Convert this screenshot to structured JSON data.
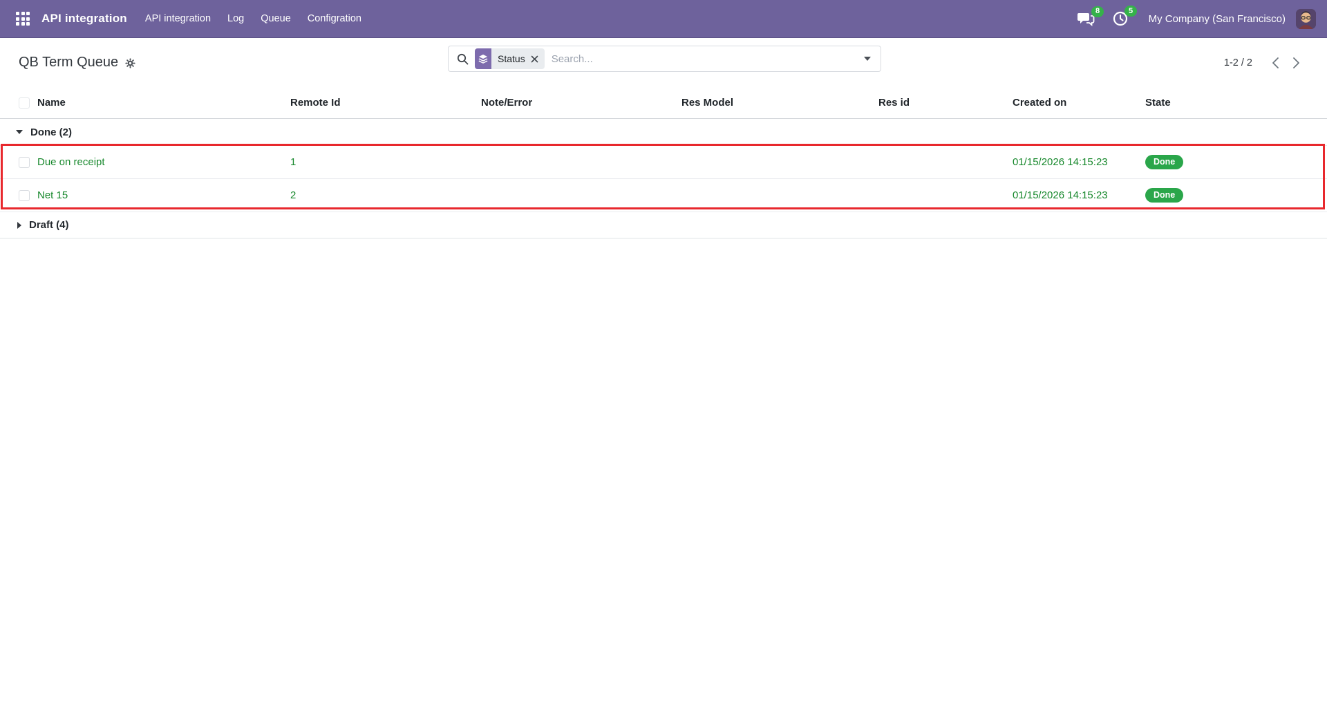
{
  "navbar": {
    "brand": "API integration",
    "menu": [
      {
        "label": "API integration"
      },
      {
        "label": "Log"
      },
      {
        "label": "Queue"
      },
      {
        "label": "Configration"
      }
    ],
    "messages_count": "8",
    "activities_count": "5",
    "company": "My Company (San Francisco)"
  },
  "control_panel": {
    "title": "QB Term Queue",
    "search": {
      "facet": "Status",
      "placeholder": "Search..."
    },
    "pager": {
      "range": "1-2 / 2"
    }
  },
  "table": {
    "headers": [
      "Name",
      "Remote Id",
      "Note/Error",
      "Res Model",
      "Res id",
      "Created on",
      "State"
    ],
    "groups": [
      {
        "label": "Done (2)",
        "expanded": true,
        "rows": [
          {
            "name": "Due on receipt",
            "remote_id": "1",
            "note_error": "",
            "res_model": "",
            "res_id": "",
            "created_on": "01/15/2026 14:15:23",
            "state": "Done"
          },
          {
            "name": "Net 15",
            "remote_id": "2",
            "note_error": "",
            "res_model": "",
            "res_id": "",
            "created_on": "01/15/2026 14:15:23",
            "state": "Done"
          }
        ]
      },
      {
        "label": "Draft (4)",
        "expanded": false
      }
    ]
  },
  "icons": {
    "apps": "grid-3x3",
    "messages": "chat-bubbles",
    "activities": "clock",
    "search": "magnifier",
    "group_by_facet": "layers",
    "facet_remove": "x",
    "search_dropdown": "caret-down",
    "settings": "gear",
    "pager_previous": "chevron-left",
    "pager_next": "chevron-right",
    "group_expanded": "caret-down",
    "group_collapsed": "caret-right"
  },
  "colors": {
    "navbar_bg": "#6e629c",
    "facet_icon_bg": "#7d6bad",
    "badge_green": "#35b24a",
    "success_text": "#17882c",
    "state_badge_bg": "#2aa64a",
    "annotation_red": "#e8282d"
  }
}
